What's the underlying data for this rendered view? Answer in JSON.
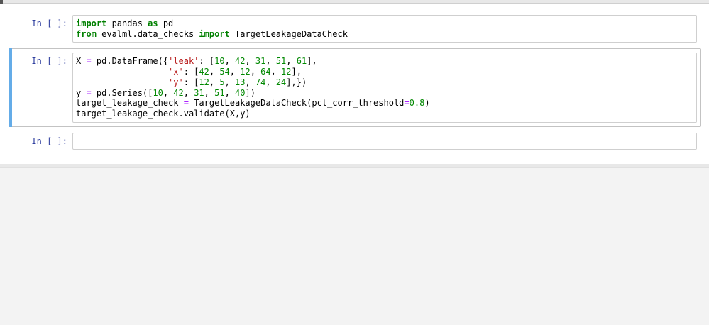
{
  "colors": {
    "selected_cell_bar": "#64ACE8",
    "selected_cell_border": "#c3c3c3",
    "editor_border": "#cfcfcf",
    "prompt_text": "#303F9F",
    "keyword": "#008000",
    "number": "#008800",
    "string": "#BA2121",
    "operator": "#AA22FF",
    "code_text": "#000000",
    "strip_bg": "#e8e8e8",
    "page_bg": "#f3f3f3",
    "notebook_bg": "#ffffff"
  },
  "notebook": {
    "cells": [
      {
        "prompt": "In [ ]:",
        "selected": false,
        "lines": [
          [
            {
              "t": "import",
              "c": "kw"
            },
            {
              "t": " pandas ",
              "c": "pl"
            },
            {
              "t": "as",
              "c": "kw"
            },
            {
              "t": " pd",
              "c": "pl"
            }
          ],
          [
            {
              "t": "from",
              "c": "kw"
            },
            {
              "t": " evalml.data_checks ",
              "c": "pl"
            },
            {
              "t": "import",
              "c": "kw"
            },
            {
              "t": " TargetLeakageDataCheck",
              "c": "pl"
            }
          ]
        ]
      },
      {
        "prompt": "In [ ]:",
        "selected": true,
        "lines": [
          [
            {
              "t": "X ",
              "c": "pl"
            },
            {
              "t": "=",
              "c": "op"
            },
            {
              "t": " pd.DataFrame({",
              "c": "pl"
            },
            {
              "t": "'leak'",
              "c": "str"
            },
            {
              "t": ": [",
              "c": "pl"
            },
            {
              "t": "10",
              "c": "num"
            },
            {
              "t": ", ",
              "c": "pl"
            },
            {
              "t": "42",
              "c": "num"
            },
            {
              "t": ", ",
              "c": "pl"
            },
            {
              "t": "31",
              "c": "num"
            },
            {
              "t": ", ",
              "c": "pl"
            },
            {
              "t": "51",
              "c": "num"
            },
            {
              "t": ", ",
              "c": "pl"
            },
            {
              "t": "61",
              "c": "num"
            },
            {
              "t": "],",
              "c": "pl"
            }
          ],
          [
            {
              "t": "                  ",
              "c": "pl"
            },
            {
              "t": "'x'",
              "c": "str"
            },
            {
              "t": ": [",
              "c": "pl"
            },
            {
              "t": "42",
              "c": "num"
            },
            {
              "t": ", ",
              "c": "pl"
            },
            {
              "t": "54",
              "c": "num"
            },
            {
              "t": ", ",
              "c": "pl"
            },
            {
              "t": "12",
              "c": "num"
            },
            {
              "t": ", ",
              "c": "pl"
            },
            {
              "t": "64",
              "c": "num"
            },
            {
              "t": ", ",
              "c": "pl"
            },
            {
              "t": "12",
              "c": "num"
            },
            {
              "t": "],",
              "c": "pl"
            }
          ],
          [
            {
              "t": "                  ",
              "c": "pl"
            },
            {
              "t": "'y'",
              "c": "str"
            },
            {
              "t": ": [",
              "c": "pl"
            },
            {
              "t": "12",
              "c": "num"
            },
            {
              "t": ", ",
              "c": "pl"
            },
            {
              "t": "5",
              "c": "num"
            },
            {
              "t": ", ",
              "c": "pl"
            },
            {
              "t": "13",
              "c": "num"
            },
            {
              "t": ", ",
              "c": "pl"
            },
            {
              "t": "74",
              "c": "num"
            },
            {
              "t": ", ",
              "c": "pl"
            },
            {
              "t": "24",
              "c": "num"
            },
            {
              "t": "],})",
              "c": "pl"
            }
          ],
          [
            {
              "t": "y ",
              "c": "pl"
            },
            {
              "t": "=",
              "c": "op"
            },
            {
              "t": " pd.Series([",
              "c": "pl"
            },
            {
              "t": "10",
              "c": "num"
            },
            {
              "t": ", ",
              "c": "pl"
            },
            {
              "t": "42",
              "c": "num"
            },
            {
              "t": ", ",
              "c": "pl"
            },
            {
              "t": "31",
              "c": "num"
            },
            {
              "t": ", ",
              "c": "pl"
            },
            {
              "t": "51",
              "c": "num"
            },
            {
              "t": ", ",
              "c": "pl"
            },
            {
              "t": "40",
              "c": "num"
            },
            {
              "t": "])",
              "c": "pl"
            }
          ],
          [
            {
              "t": "target_leakage_check ",
              "c": "pl"
            },
            {
              "t": "=",
              "c": "op"
            },
            {
              "t": " TargetLeakageDataCheck(pct_corr_threshold",
              "c": "pl"
            },
            {
              "t": "=",
              "c": "op"
            },
            {
              "t": "0.8",
              "c": "num"
            },
            {
              "t": ")",
              "c": "pl"
            }
          ],
          [
            {
              "t": "target_leakage_check.validate(X,y)",
              "c": "pl"
            }
          ]
        ]
      },
      {
        "prompt": "In [ ]:",
        "selected": false,
        "lines": [
          []
        ]
      }
    ]
  }
}
